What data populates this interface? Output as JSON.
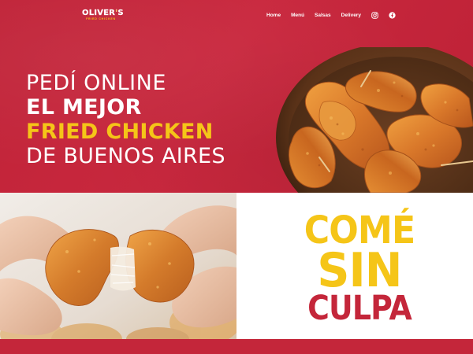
{
  "brand": {
    "name_main": "OLIVER",
    "name_apos": "'",
    "name_end": "S",
    "tagline": "FRIED CHICKEN"
  },
  "nav": {
    "items": [
      "Home",
      "Menú",
      "Salsas",
      "Delivery"
    ],
    "instagram_icon": "instagram-icon",
    "facebook_icon": "facebook-icon"
  },
  "hero": {
    "line1": "PEDÍ ONLINE",
    "line2": "EL MEJOR",
    "line3": "FRIED CHICKEN",
    "line4": "DE BUENOS AIRES"
  },
  "promo": {
    "line1": "COMÉ",
    "line2": "SIN",
    "line3": "CULPA"
  },
  "colors": {
    "brand_red": "#c4263a",
    "brand_yellow": "#f5c518",
    "white": "#ffffff"
  }
}
